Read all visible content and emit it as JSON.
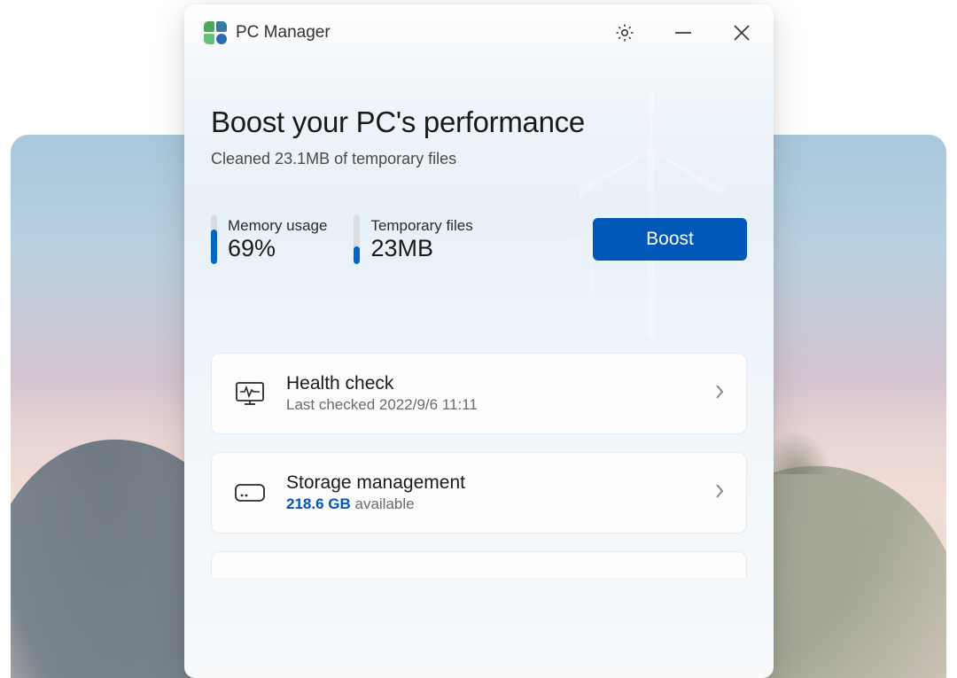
{
  "app": {
    "title": "PC Manager"
  },
  "hero": {
    "headline": "Boost your PC's performance",
    "subhead": "Cleaned 23.1MB of temporary files"
  },
  "stats": {
    "memory": {
      "label": "Memory usage",
      "value": "69%",
      "fill_percent": 69
    },
    "temp": {
      "label": "Temporary files",
      "value": "23MB",
      "fill_percent": 35
    }
  },
  "actions": {
    "boost_label": "Boost"
  },
  "cards": {
    "health": {
      "title": "Health check",
      "sub": "Last checked 2022/9/6 11:11"
    },
    "storage": {
      "title": "Storage management",
      "available_value": "218.6 GB",
      "available_suffix": " available"
    }
  }
}
